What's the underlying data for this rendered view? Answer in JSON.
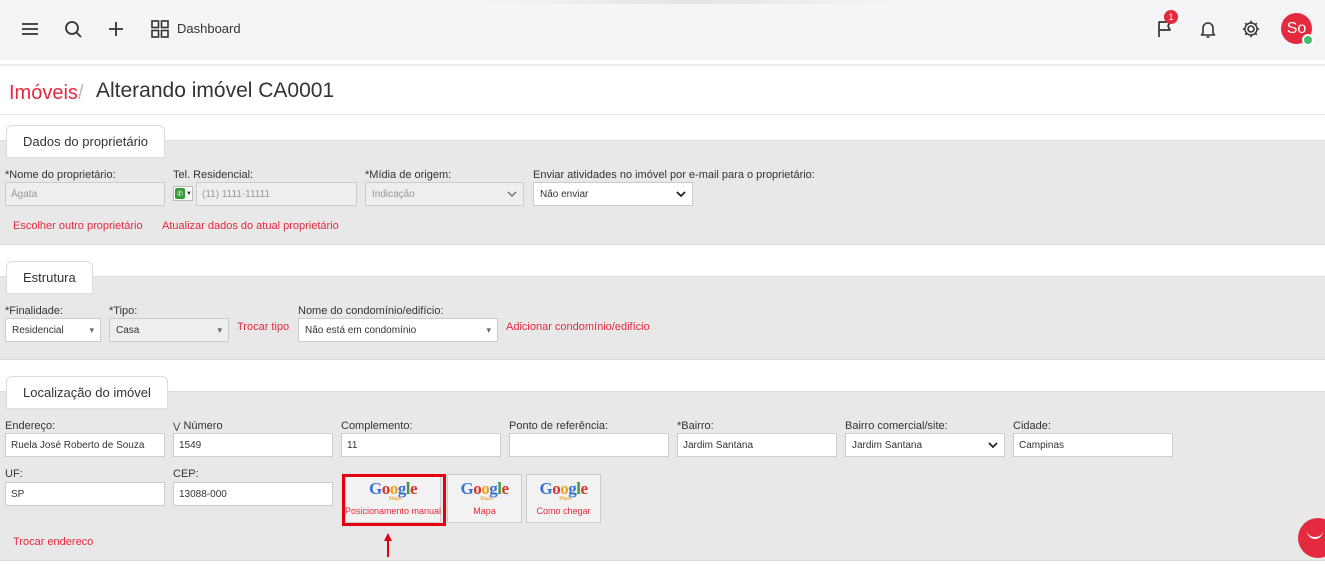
{
  "topbar": {
    "dashboard_label": "Dashboard",
    "flag_badge": "1",
    "avatar_initials": "So",
    "icons": [
      "menu-icon",
      "search-icon",
      "plus-icon",
      "grid-icon",
      "flag-icon",
      "bell-icon",
      "gear-icon"
    ]
  },
  "breadcrumb": {
    "link": "Imóveis",
    "separator": "/",
    "title": "Alterando imóvel CA0001"
  },
  "owner": {
    "tab": "Dados do proprietário",
    "name_label": "*Nome do proprietário:",
    "name_value": "Ágata",
    "phone_label": "Tel. Residencial:",
    "phone_placeholder": "(11) 1111-11111",
    "media_label": "*Mídia de origem:",
    "media_value": "Indicação",
    "email_label": "Enviar atividades no imóvel por e-mail para o proprietário:",
    "email_value": "Não enviar",
    "link_choose": "Escolher outro proprietário",
    "link_update": "Atualizar dados do atual proprietário"
  },
  "structure": {
    "tab": "Estrutura",
    "purpose_label": "*Finalidade:",
    "purpose_value": "Residencial",
    "type_label": "*Tipo:",
    "type_value": "Casa",
    "change_type": "Trocar tipo",
    "condo_label": "Nome do condomínio/edifício:",
    "condo_value": "Não está em condomínio",
    "add_condo": "Adicionar condomínio/edifício"
  },
  "location": {
    "tab": "Localização do imóvel",
    "address_label": "Endereço:",
    "address_value": "Ruela José Roberto de Souza",
    "number_label": "Número",
    "number_value": "1549",
    "complement_label": "Complemento:",
    "complement_value": "11",
    "reference_label": "Ponto de referência:",
    "reference_value": "",
    "district_label": "*Bairro:",
    "district_value": "Jardim Santana",
    "commercial_label": "Bairro comercial/site:",
    "commercial_value": "Jardim Santana",
    "city_label": "Cidade:",
    "city_value": "Campinas",
    "state_label": "UF:",
    "state_value": "SP",
    "zip_label": "CEP:",
    "zip_value": "13088-000",
    "change_address": "Trocar endereco",
    "google_logo": "Google",
    "google_maps_tag": "Maps",
    "btn_manual": "Posicionamento manual",
    "btn_map": "Mapa",
    "btn_directions": "Como chegar"
  },
  "colors": {
    "accent": "#e5293e",
    "highlight": "#e00010",
    "section_bg": "#e8e8e8"
  }
}
